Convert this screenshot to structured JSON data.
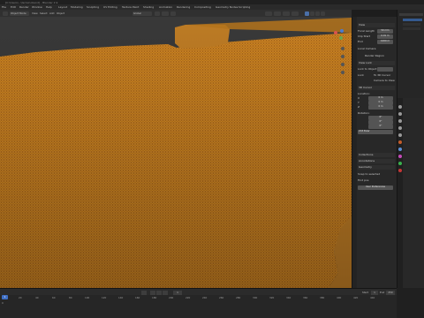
{
  "title_bar": {
    "text": "[C:\\Users\\...\\terrain.blend] - Blender 2.9"
  },
  "menu": {
    "items": [
      "File",
      "Edit",
      "Render",
      "Window",
      "Help",
      "Layout",
      "Modeling",
      "Sculpting",
      "UV Editing",
      "Texture Paint",
      "Shading",
      "Animation",
      "Rendering",
      "Compositing",
      "Geometry Nodes",
      "Scripting"
    ]
  },
  "viewport_header": {
    "mode": "Object Mode",
    "view": "View",
    "select": "Select",
    "add": "Add",
    "object": "Object",
    "transform_orientation": "Global"
  },
  "npanel": {
    "view_section": "View",
    "focal_length_label": "Focal Length",
    "focal_length_value": "50 mm",
    "clip_start_label": "Clip Start",
    "clip_start_value": "0.01 m",
    "clip_end_label": "End",
    "clip_end_value": "1000 m",
    "local_camera_label": "Local Camera",
    "render_region_label": "Render Region",
    "view_lock_label": "View Lock",
    "lock_to_object_label": "Lock to Object",
    "lock_label": "Lock",
    "lock_3d_cursor": "To 3D Cursor",
    "lock_camera": "Camera to View",
    "cursor_section": "3D Cursor",
    "location_label": "Location:",
    "x_label": "X",
    "x_value": "0 m",
    "y_label": "Y",
    "y_value": "0 m",
    "z_label": "Z",
    "z_value": "0 m",
    "rotation_label": "Rotation:",
    "rx_value": "0°",
    "ry_value": "0°",
    "rz_value": "0°",
    "rotation_mode": "XYZ Euler",
    "collections_section": "Collections",
    "annotations_section": "Annotations",
    "maps_section": "Geometry",
    "blenderkit_label": "Snap to selected",
    "find_label": "Find pos",
    "user_preferences": "User Preferences"
  },
  "timeline": {
    "current_frame": "1",
    "ticks": [
      "0",
      "20",
      "40",
      "60",
      "80",
      "100",
      "120",
      "140",
      "160",
      "180",
      "200",
      "220",
      "240",
      "260",
      "280",
      "300",
      "320",
      "340",
      "360",
      "380",
      "400",
      "420",
      "440"
    ],
    "start_label": "Start",
    "start_value": "1",
    "end_label": "End",
    "end_value": "250"
  },
  "colors": {
    "wireframe": "#e8951e",
    "background": "#3f3f3f",
    "accent_blue": "#3f6fc4"
  }
}
